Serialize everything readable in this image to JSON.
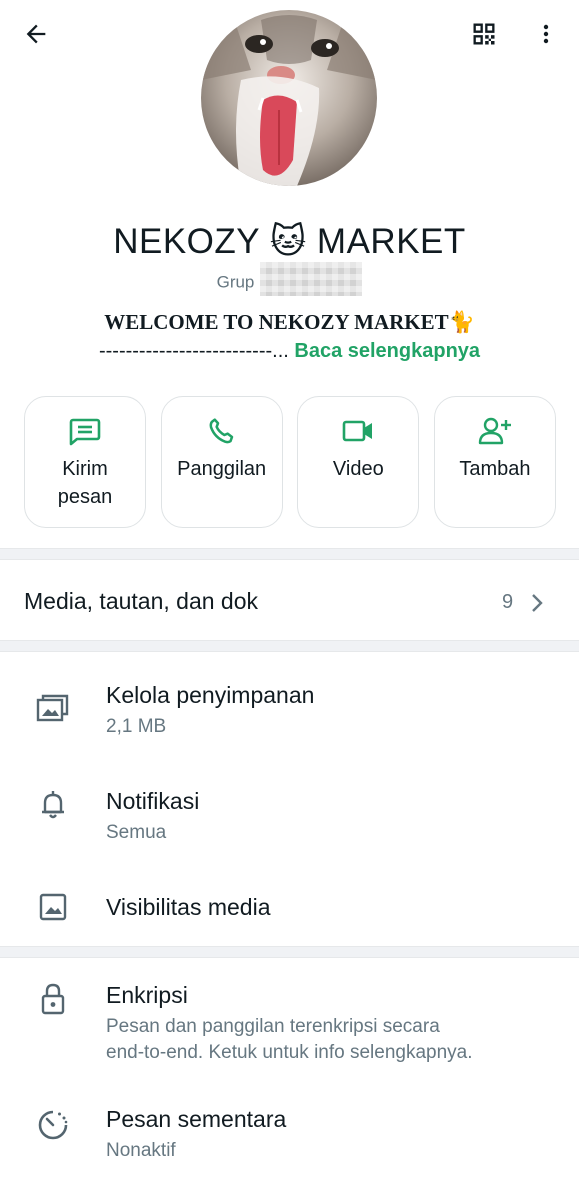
{
  "header": {
    "back_icon": "arrow-left-icon",
    "qr_icon": "qr-code-icon",
    "menu_icon": "more-vertical-icon"
  },
  "profile": {
    "avatar_alt": "cat photo",
    "name": "NEKOZY 🐱 MARKET",
    "type_label": "Grup",
    "description_line1": "WELCOME TO NEKOZY MARKET🐈",
    "description_line2": "--------------------------...",
    "read_more": "Baca selengkapnya"
  },
  "actions": [
    {
      "label": "Kirim pesan",
      "icon": "message-icon"
    },
    {
      "label": "Panggilan",
      "icon": "phone-icon"
    },
    {
      "label": "Video",
      "icon": "video-icon"
    },
    {
      "label": "Tambah",
      "icon": "add-person-icon"
    }
  ],
  "media": {
    "label": "Media, tautan, dan dok",
    "count": "9"
  },
  "settings": [
    {
      "title": "Kelola penyimpanan",
      "subtitle": "2,1 MB",
      "icon": "storage-folder-icon"
    },
    {
      "title": "Notifikasi",
      "subtitle": "Semua",
      "icon": "bell-icon"
    },
    {
      "title": "Visibilitas media",
      "subtitle": "",
      "icon": "image-icon"
    }
  ],
  "security": [
    {
      "title": "Enkripsi",
      "subtitle_line1": "Pesan dan panggilan terenkripsi secara",
      "subtitle_line2": "end-to-end. Ketuk untuk info selengkapnya.",
      "icon": "lock-icon"
    },
    {
      "title": "Pesan sementara",
      "subtitle": "Nonaktif",
      "icon": "timer-icon"
    }
  ],
  "colors": {
    "accent": "#21a366",
    "text_primary": "#111b21",
    "text_secondary": "#667781",
    "divider": "#f0f2f5"
  }
}
